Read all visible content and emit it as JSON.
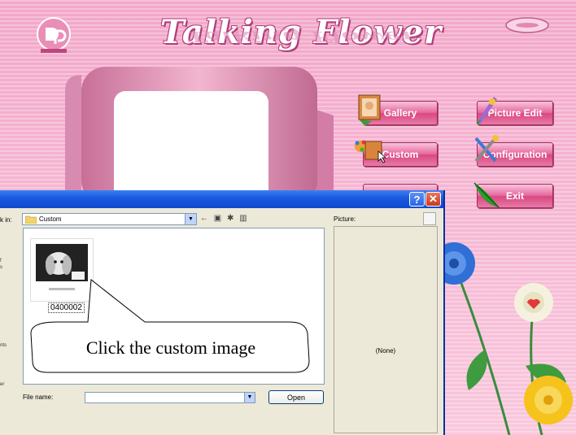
{
  "app": {
    "title": "Talking Flower",
    "buttons": {
      "gallery": "Gallery",
      "custom": "Custom",
      "picture_edit": "Picture Edit",
      "configuration": "Configuration",
      "exit": "Exit"
    },
    "colors": {
      "accent": "#e7679f",
      "title_outline": "#b23d7a"
    }
  },
  "dialog": {
    "look_in_label": "k in:",
    "look_in_value": "Custom",
    "picture_label": "Picture:",
    "preview_text": "(None)",
    "file_item_label": "0400002",
    "file_name_label": "File name:",
    "open_button": "Open",
    "places": [
      "f",
      "s",
      "nts",
      "er"
    ]
  },
  "callout": {
    "text": "Click the custom image"
  }
}
